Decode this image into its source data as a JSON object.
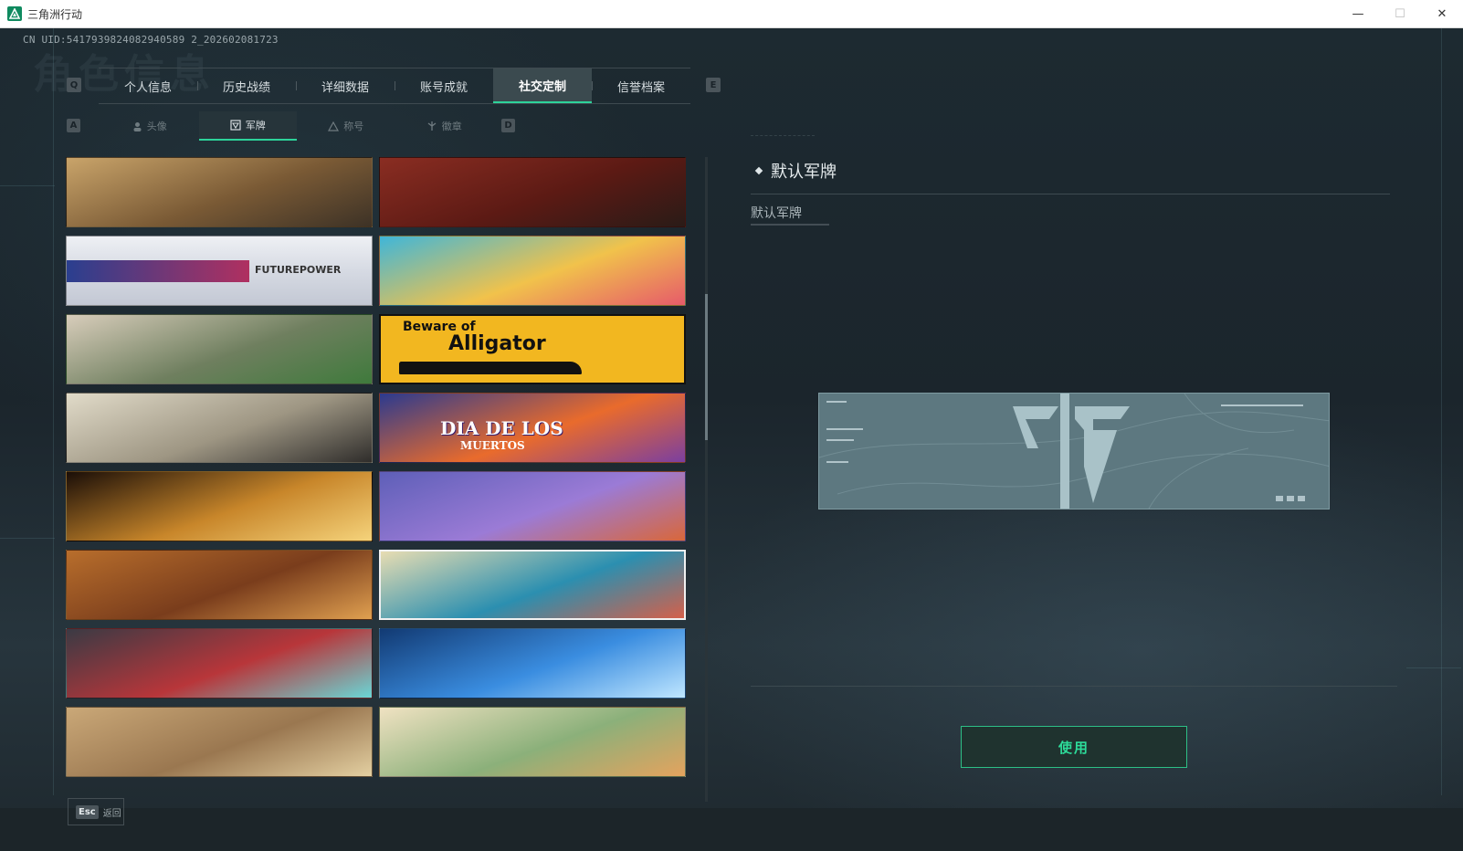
{
  "window": {
    "title": "三角洲行动",
    "minimize": "—",
    "maximize": "☐",
    "close": "✕"
  },
  "header": {
    "uid": "CN UID:5417939824082940589 2_202602081723",
    "bg_title": "角色信息"
  },
  "main_tabs": {
    "prev_key": "Q",
    "next_key": "E",
    "items": [
      {
        "label": "个人信息"
      },
      {
        "label": "历史战绩"
      },
      {
        "label": "详细数据"
      },
      {
        "label": "账号成就"
      },
      {
        "label": "社交定制",
        "active": true
      },
      {
        "label": "信誉档案"
      }
    ]
  },
  "sub_tabs": {
    "prev_key": "A",
    "next_key": "D",
    "items": [
      {
        "label": "头像",
        "icon": "person-icon"
      },
      {
        "label": "军牌",
        "icon": "dogtag-icon",
        "active": true
      },
      {
        "label": "称号",
        "icon": "triangle-icon"
      },
      {
        "label": "徽章",
        "icon": "badge-icon"
      }
    ]
  },
  "cards": [
    {
      "name": "desert-town",
      "colors": [
        "#c9a46a",
        "#7a5a35",
        "#3d3226"
      ]
    },
    {
      "name": "squad-soldiers",
      "colors": [
        "#8a2d22",
        "#5c1a14",
        "#2a1b17"
      ]
    },
    {
      "name": "future-power",
      "colors": [
        "#e6e9ef",
        "#8aa0cc",
        "#b03060"
      ],
      "text": "FUTUREPOWER"
    },
    {
      "name": "beach-chef",
      "colors": [
        "#3fb6d9",
        "#f1c24b",
        "#e65b6a"
      ]
    },
    {
      "name": "cafe-girl",
      "colors": [
        "#d8cdbb",
        "#6f7f5f",
        "#3f7a3c"
      ]
    },
    {
      "name": "beware-of-alligator",
      "colors": [
        "#f2b720",
        "#f2b720",
        "#111111"
      ],
      "text_line1": "Beware of",
      "text_line2": "Alligator"
    },
    {
      "name": "windmill-knight",
      "colors": [
        "#e1dbc9",
        "#9e9683",
        "#2f2d2b"
      ]
    },
    {
      "name": "dia-de-los-muertos",
      "colors": [
        "#2b3a8f",
        "#e96b2c",
        "#7b3fa0"
      ],
      "text_line1": "DIA DE LOS",
      "text_line2": "MUERTOS"
    },
    {
      "name": "candle-swan",
      "colors": [
        "#1a0e08",
        "#c8862a",
        "#f5d37b"
      ]
    },
    {
      "name": "sugar-skull-graveyard",
      "colors": [
        "#5e5fb8",
        "#9b7bd6",
        "#d9673a"
      ]
    },
    {
      "name": "autumn-skeleton",
      "colors": [
        "#b86e2c",
        "#7a3d1c",
        "#e0a050"
      ]
    },
    {
      "name": "kraken-wave",
      "colors": [
        "#e8ddb2",
        "#2b8fb0",
        "#d5604a"
      ]
    },
    {
      "name": "pixel-game",
      "colors": [
        "#3a3a44",
        "#b8363a",
        "#6ad6d6"
      ]
    },
    {
      "name": "xray-skeletons",
      "colors": [
        "#123a73",
        "#3a8de0",
        "#bfe6ff"
      ]
    },
    {
      "name": "ancient-map",
      "colors": [
        "#caa878",
        "#9a7750",
        "#e3cfa1"
      ]
    },
    {
      "name": "kitchen-girl",
      "colors": [
        "#f0e2c2",
        "#8bb07a",
        "#e4a35e"
      ]
    }
  ],
  "detail": {
    "title": "默认军牌",
    "description": "默认军牌",
    "use_button": "使用"
  },
  "footer": {
    "esc_key": "Esc",
    "back_label": "返回"
  },
  "colors": {
    "accent": "#2dd39a",
    "background": "#1a2329"
  }
}
